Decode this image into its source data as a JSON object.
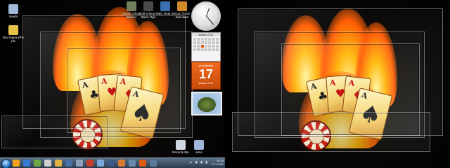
{
  "desktop_icons_left": [
    {
      "label": "ceedn",
      "color": "#9fb7d8"
    },
    {
      "label": "Nov mapa Elho pls",
      "color": "#e8c14a"
    }
  ],
  "desktop_icons_top": [
    {
      "label": "Sniper Ghost Warrior",
      "color": "#6e7f5a"
    },
    {
      "label": "Call of Duty - Black Ops",
      "color": "#4a4a4a"
    },
    {
      "label": "NBC Real IS",
      "color": "#3a6fb0"
    },
    {
      "label": "Euro Truck Simulator",
      "color": "#d08a2a"
    }
  ],
  "desktop_icons_bottom": [
    {
      "label": "Recycle Bin",
      "color": "#cfd8e2"
    },
    {
      "label": "sime",
      "color": "#9fb7d8"
    }
  ],
  "date_gadget": {
    "dow": "ponedjeljak",
    "day": "17",
    "month": "januar 2011"
  },
  "calendar_gadget": {
    "title": "januar 2011"
  },
  "taskbar": {
    "time": "20:29",
    "date": "17.1.2011",
    "tray_icons": "▲ ◆ ◉ ▮",
    "apps": [
      "#f2a51a",
      "#3a7bd5",
      "#6fa842",
      "#d0d0d0",
      "#e0b040",
      "#4a6fa5",
      "#8fa3b8",
      "#c83a2a",
      "#7aa6d8",
      "#3a5a8a",
      "#d87a30",
      "#6a8ab0",
      "#e05a10",
      "#5a7a9a"
    ]
  },
  "colors": {
    "accent": "#e05a10",
    "taskbar": "#2a3b4e"
  }
}
